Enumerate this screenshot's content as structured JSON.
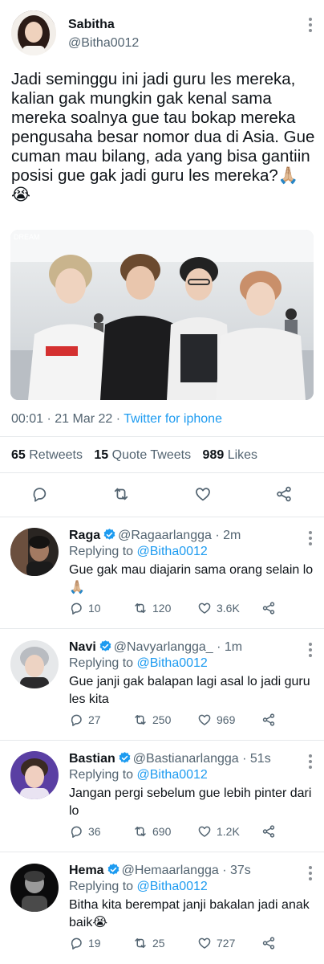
{
  "tweet": {
    "author_name": "Sabitha",
    "author_handle": "@Bitha0012",
    "text": "Jadi seminggu ini jadi guru les mereka, kalian gak mungkin gak kenal sama mereka soalnya gue tau bokap mereka pengusaha besar nomor dua di Asia. Gue cuman mau bilang, ada yang bisa gantiin posisi gue gak jadi guru les mereka?🙏🏼😭",
    "time": "00:01",
    "date": "21 Mar 22",
    "client": "Twitter for iphone",
    "retweets_count": "65",
    "retweets_label": "Retweets",
    "quotes_count": "15",
    "quotes_label": "Quote Tweets",
    "likes_count": "989",
    "likes_label": "Likes",
    "photo_overlay_text": "DREAM"
  },
  "replies": [
    {
      "name": "Raga",
      "handle": "@Ragaarlangga",
      "age": "2m",
      "replying_label": "Replying to",
      "replying_to": "@Bitha0012",
      "text": "Gue gak mau diajarin sama orang selain lo🙏🏼",
      "replies": "10",
      "retweets": "120",
      "likes": "3.6K"
    },
    {
      "name": "Navi",
      "handle": "@Navyarlangga_",
      "age": "1m",
      "replying_label": "Replying to",
      "replying_to": "@Bitha0012",
      "text": "Gue janji gak balapan lagi asal lo jadi guru les kita",
      "replies": "27",
      "retweets": "250",
      "likes": "969"
    },
    {
      "name": "Bastian",
      "handle": "@Bastianarlangga",
      "age": "51s",
      "replying_label": "Replying to",
      "replying_to": "@Bitha0012",
      "text": "Jangan pergi sebelum gue lebih pinter dari lo",
      "replies": "36",
      "retweets": "690",
      "likes": "1.2K"
    },
    {
      "name": "Hema",
      "handle": "@Hemaarlangga",
      "age": "37s",
      "replying_label": "Replying to",
      "replying_to": "@Bitha0012",
      "text": "Bitha kita berempat janji bakalan jadi anak baik😭",
      "replies": "19",
      "retweets": "25",
      "likes": "727"
    }
  ],
  "colors": {
    "link": "#1d9bf0",
    "muted": "#536471",
    "verified": "#1d9bf0"
  },
  "icons": [
    "reply-icon",
    "retweet-icon",
    "like-icon",
    "share-icon",
    "more-options-icon",
    "verified-badge-icon"
  ]
}
